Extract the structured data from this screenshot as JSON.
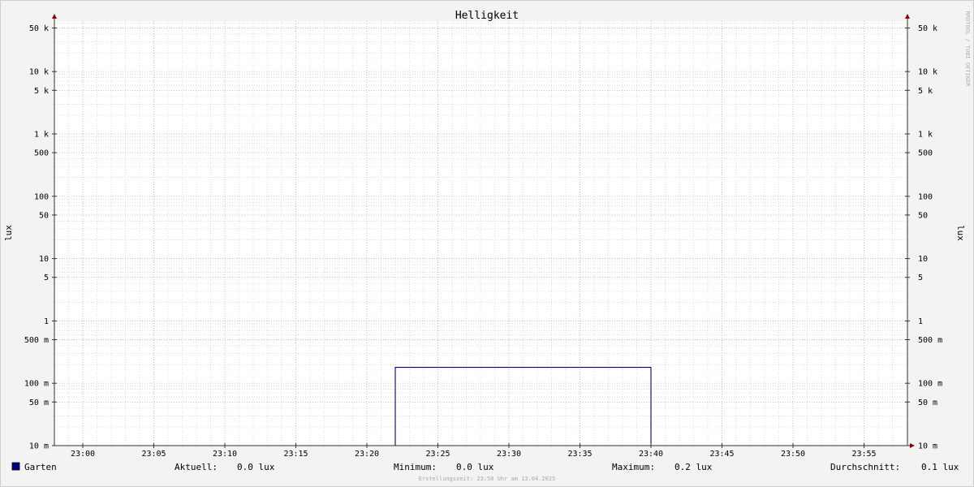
{
  "chart_data": {
    "type": "line",
    "title": "Helligkeit",
    "ylabel_left": "lux",
    "ylabel_right": "lux",
    "y_scale": "log",
    "ylim": [
      0.01,
      80000
    ],
    "xlim": [
      "22:58",
      "23:58"
    ],
    "x_ticks": [
      "23:00",
      "23:05",
      "23:10",
      "23:15",
      "23:20",
      "23:25",
      "23:30",
      "23:35",
      "23:40",
      "23:45",
      "23:50",
      "23:55"
    ],
    "y_ticks": [
      {
        "value": 50000,
        "label": "50 k"
      },
      {
        "value": 10000,
        "label": "10 k"
      },
      {
        "value": 5000,
        "label": "5 k"
      },
      {
        "value": 1000,
        "label": "1 k"
      },
      {
        "value": 500,
        "label": "500"
      },
      {
        "value": 100,
        "label": "100"
      },
      {
        "value": 50,
        "label": "50"
      },
      {
        "value": 10,
        "label": "10"
      },
      {
        "value": 5,
        "label": "5"
      },
      {
        "value": 1,
        "label": "1"
      },
      {
        "value": 0.5,
        "label": "500 m"
      },
      {
        "value": 0.1,
        "label": "100 m"
      },
      {
        "value": 0.05,
        "label": "50 m"
      },
      {
        "value": 0.01,
        "label": "10 m"
      }
    ],
    "grid": true,
    "series": [
      {
        "name": "Garten",
        "color": "#000080",
        "x": [
          "22:58",
          "23:22",
          "23:22",
          "23:40",
          "23:40",
          "23:58"
        ],
        "y": [
          0.01,
          0.01,
          0.18,
          0.18,
          0.01,
          0.01
        ]
      }
    ],
    "legend": {
      "series_label": "Garten",
      "stats": [
        {
          "label": "Aktuell:",
          "value": "0.0 lux"
        },
        {
          "label": "Minimum:",
          "value": "0.0 lux"
        },
        {
          "label": "Maximum:",
          "value": "0.2 lux"
        },
        {
          "label": "Durchschnitt:",
          "value": "0.1 lux"
        }
      ]
    },
    "footer": "Erstellungszeit: 23:58 Uhr am 13.04.2025",
    "watermark": "RRDTOOL / TOBI OETIKER",
    "colors": {
      "background": "#f3f3f3",
      "plot_background": "#ffffff",
      "major_grid": "#e8a0a0",
      "minor_grid": "#c8c8c8",
      "axis": "#333333",
      "arrow": "#8b0000",
      "series": "#000080"
    }
  }
}
